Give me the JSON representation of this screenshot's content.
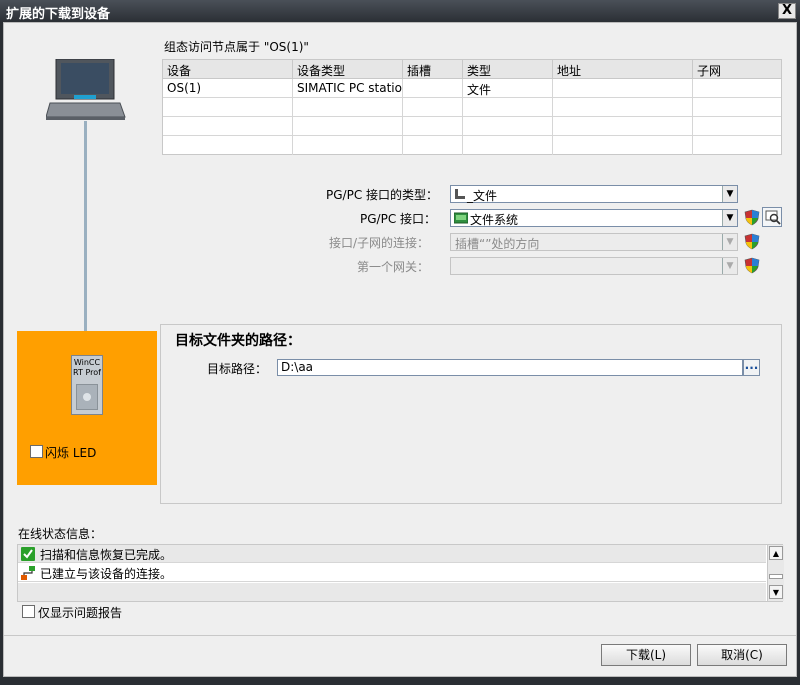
{
  "window": {
    "title": "扩展的下载到设备",
    "close_label": "X"
  },
  "device_caption": "组态访问节点属于 \"OS(1)\"",
  "table": {
    "headers": [
      "设备",
      "设备类型",
      "插槽",
      "类型",
      "地址",
      "子网"
    ],
    "rows": [
      [
        "OS(1)",
        "SIMATIC PC statio...",
        "",
        "文件",
        "",
        ""
      ],
      [
        "",
        "",
        "",
        "",
        "",
        ""
      ],
      [
        "",
        "",
        "",
        "",
        "",
        ""
      ],
      [
        "",
        "",
        "",
        "",
        "",
        ""
      ]
    ]
  },
  "interface": {
    "type_label": "PG/PC 接口的类型：",
    "type_value": "_文件",
    "iface_label": "PG/PC 接口：",
    "iface_value": "文件系统",
    "conn_label": "接口/子网的连接：",
    "conn_value": "插槽“”处的方向",
    "gateway_label": "第一个网关：",
    "gateway_value": ""
  },
  "module": {
    "line1": "WinCC",
    "line2": "RT Prof"
  },
  "flash_led_label": "闪烁 LED",
  "target": {
    "heading": "目标文件夹的路径：",
    "path_label": "目标路径：",
    "path_value": "D:\\aa",
    "browse_label": "..."
  },
  "status": {
    "heading": "在线状态信息：",
    "items": [
      "扫描和信息恢复已完成。",
      "已建立与该设备的连接。"
    ]
  },
  "only_problems_label": "仅显示问题报告",
  "buttons": {
    "download": "下载(L)",
    "cancel": "取消(C)"
  },
  "colors": {
    "highlight": "#ff9f00",
    "titlebar": "#2b2f35",
    "ok_green": "#2aa02a"
  }
}
